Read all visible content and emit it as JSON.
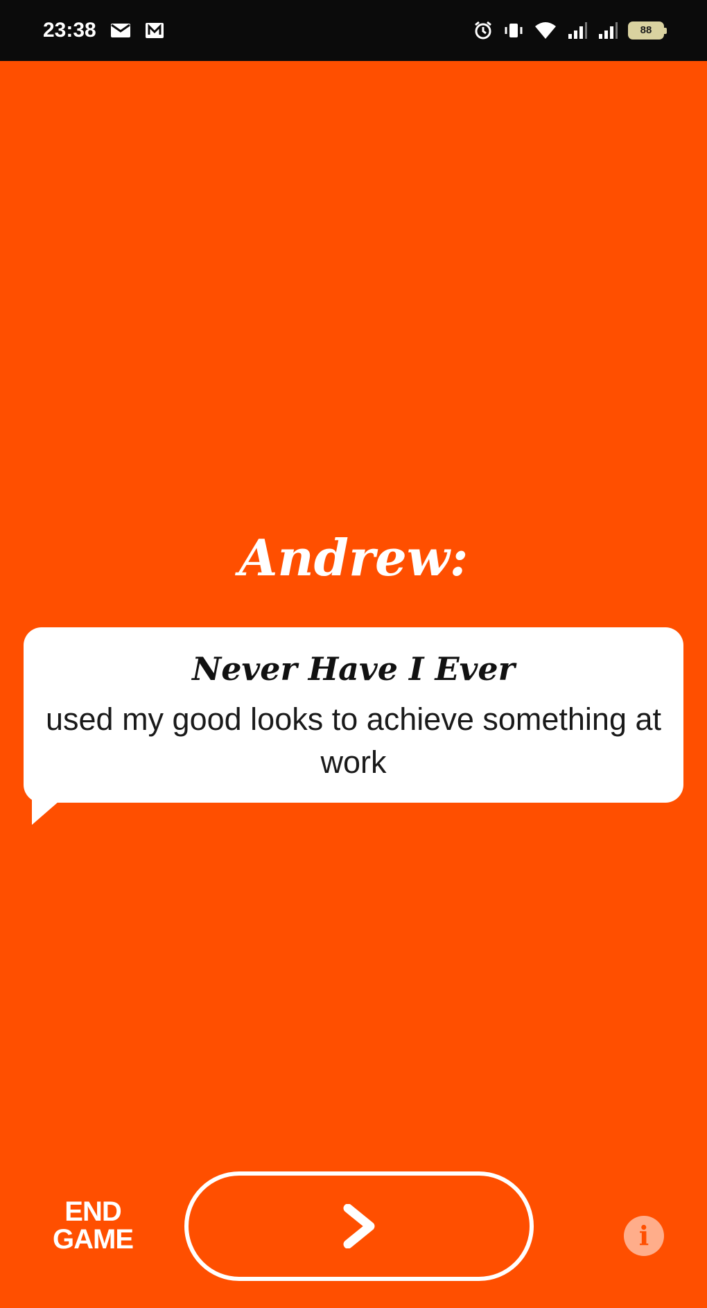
{
  "status_bar": {
    "time": "23:38",
    "left_icons": [
      "mail-icon",
      "notification-icon"
    ],
    "right_icons": [
      "alarm-icon",
      "vibrate-icon",
      "wifi-icon",
      "signal-icon",
      "signal-icon"
    ],
    "battery": "88"
  },
  "game": {
    "player_name": "Andrew:",
    "card_title": "Never Have I Ever",
    "card_text": "used my good looks to achieve something at work"
  },
  "controls": {
    "end_game_label": "END GAME",
    "next_icon": "chevron-right-icon",
    "info_icon": "info-icon",
    "info_glyph": "i"
  },
  "colors": {
    "background": "#ff4f00",
    "card": "#ffffff",
    "status_bar": "#0b0b0b"
  }
}
